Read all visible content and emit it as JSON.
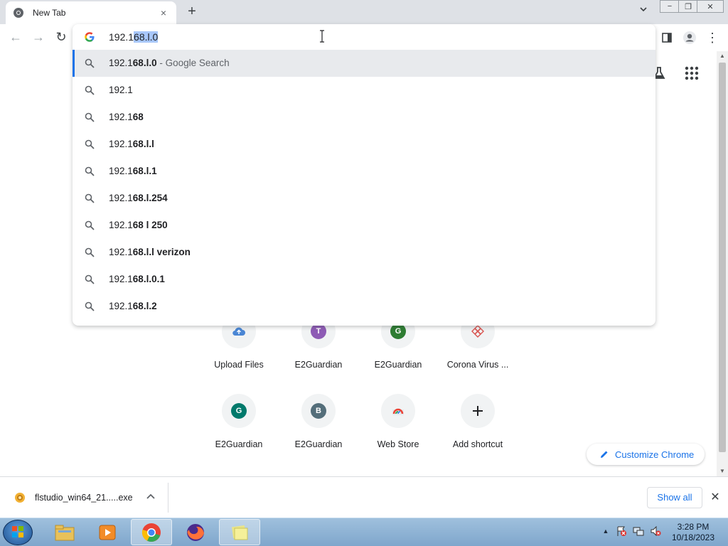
{
  "tab": {
    "title": "New Tab",
    "close": "×",
    "new_tab": "+"
  },
  "window": {
    "minimize": "−",
    "restore": "❐",
    "close": "✕"
  },
  "toolbar": {
    "back": "←",
    "forward": "→",
    "reload": "↻",
    "menu": "⋮"
  },
  "omnibox": {
    "text_plain": "192.1",
    "text_selected": "68.l.0"
  },
  "suggestions": [
    {
      "plain": "192.1",
      "bold": "68.l.0",
      "suffix": " - Google Search"
    },
    {
      "plain": "192.1",
      "bold": "",
      "suffix": ""
    },
    {
      "plain": "192.1",
      "bold": "68",
      "suffix": ""
    },
    {
      "plain": "192.1",
      "bold": "68.l.l",
      "suffix": ""
    },
    {
      "plain": "192.1",
      "bold": "68.l.1",
      "suffix": ""
    },
    {
      "plain": "192.1",
      "bold": "68.l.254",
      "suffix": ""
    },
    {
      "plain": "192.1",
      "bold": "68 l 250",
      "suffix": ""
    },
    {
      "plain": "192.1",
      "bold": "68.l.l verizon",
      "suffix": ""
    },
    {
      "plain": "192.1",
      "bold": "68.l.0.1",
      "suffix": ""
    },
    {
      "plain": "192.1",
      "bold": "68.l.2",
      "suffix": ""
    }
  ],
  "shortcuts_row1": [
    {
      "label": "Upload Files",
      "icon": "cloud-upload-icon"
    },
    {
      "label": "E2Guardian",
      "letter": "T",
      "color": "#8e5bb5"
    },
    {
      "label": "E2Guardian",
      "letter": "G",
      "color": "#2e7d32"
    },
    {
      "label": "Corona Virus ...",
      "icon": "virus-icon"
    }
  ],
  "shortcuts_row2": [
    {
      "label": "E2Guardian",
      "letter": "G",
      "color": "#00796b"
    },
    {
      "label": "E2Guardian",
      "letter": "B",
      "color": "#546e7a"
    },
    {
      "label": "Web Store",
      "icon": "web-store-icon"
    },
    {
      "label": "Add shortcut",
      "icon": "plus-icon"
    }
  ],
  "customize": {
    "label": "Customize Chrome"
  },
  "download": {
    "filename": "flstudio_win64_21.....exe",
    "show_all": "Show all",
    "close": "✕"
  },
  "clock": {
    "time": "3:28 PM",
    "date": "10/18/2023"
  },
  "tray": {
    "arrow": "▲"
  },
  "colors": {
    "accent": "#1a73e8",
    "tabstrip": "#dee1e6",
    "taskbar": "#8fb3d6"
  }
}
